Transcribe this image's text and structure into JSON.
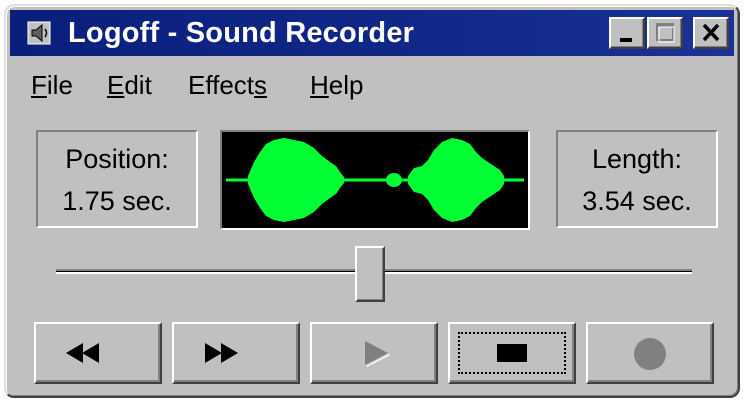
{
  "window": {
    "title": "Logoff - Sound Recorder",
    "title_bar_color": "#0a1f7a",
    "face_color": "#c0c0c0"
  },
  "title_buttons": [
    {
      "name": "minimize",
      "icon": "minimize-icon"
    },
    {
      "name": "maximize",
      "icon": "maximize-icon",
      "enabled": false
    },
    {
      "name": "close",
      "icon": "close-icon"
    }
  ],
  "menu": {
    "file": {
      "pre": "",
      "accel": "F",
      "post": "ile"
    },
    "edit": {
      "pre": "",
      "accel": "E",
      "post": "dit"
    },
    "effects": {
      "pre": "Effect",
      "accel": "s",
      "post": ""
    },
    "help": {
      "pre": "",
      "accel": "H",
      "post": "elp"
    }
  },
  "position": {
    "label": "Position:",
    "value": "1.75 sec."
  },
  "length": {
    "label": "Length:",
    "value": "3.54 sec."
  },
  "waveform": {
    "color": "#00ff33",
    "background": "#000000"
  },
  "slider": {
    "position_fraction": 0.494
  },
  "controls": [
    {
      "name": "seek-to-start",
      "icon": "rewind-icon",
      "enabled": true
    },
    {
      "name": "seek-to-end",
      "icon": "fast-forward-icon",
      "enabled": true
    },
    {
      "name": "play",
      "icon": "play-icon",
      "enabled": false
    },
    {
      "name": "stop",
      "icon": "stop-icon",
      "enabled": true,
      "focused": true
    },
    {
      "name": "record",
      "icon": "record-icon",
      "enabled": false
    }
  ],
  "disabled_color": "#808080"
}
